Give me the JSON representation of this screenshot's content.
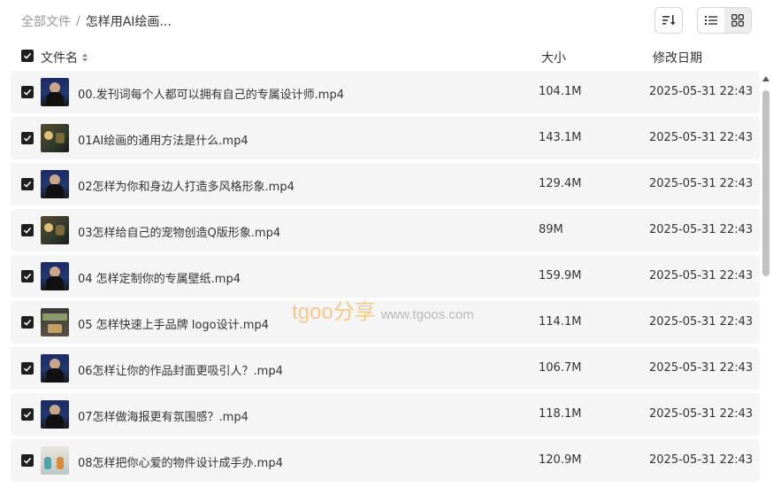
{
  "breadcrumb": {
    "root": "全部文件",
    "separator": "/",
    "current": "怎样用AI绘画..."
  },
  "toolbar": {
    "sort_icon": "sort-descending-icon",
    "list_view_icon": "list-view-icon",
    "grid_view_icon": "grid-view-icon",
    "active_view": "grid"
  },
  "header": {
    "name": "文件名",
    "size": "大小",
    "date": "修改日期"
  },
  "files": [
    {
      "name": "00.发刊词每个人都可以拥有自己的专属设计师.mp4",
      "size": "104.1M",
      "date": "2025-05-31 22:43",
      "thumb": "person",
      "checked": true
    },
    {
      "name": "01AI绘画的通用方法是什么.mp4",
      "size": "143.1M",
      "date": "2025-05-31 22:43",
      "thumb": "alt",
      "checked": true
    },
    {
      "name": "02怎样为你和身边人打造多风格形象.mp4",
      "size": "129.4M",
      "date": "2025-05-31 22:43",
      "thumb": "person",
      "checked": true
    },
    {
      "name": "03怎样给自己的宠物创造Q版形象.mp4",
      "size": "89M",
      "date": "2025-05-31 22:43",
      "thumb": "alt",
      "checked": true
    },
    {
      "name": "04 怎样定制你的专属壁纸.mp4",
      "size": "159.9M",
      "date": "2025-05-31 22:43",
      "thumb": "person",
      "checked": true
    },
    {
      "name": "05 怎样快速上手品牌 logo设计.mp4",
      "size": "114.1M",
      "date": "2025-05-31 22:43",
      "thumb": "dark2",
      "checked": true
    },
    {
      "name": "06怎样让你的作品封面更吸引人？.mp4",
      "size": "106.7M",
      "date": "2025-05-31 22:43",
      "thumb": "person",
      "checked": true
    },
    {
      "name": "07怎样做海报更有氛围感？.mp4",
      "size": "118.1M",
      "date": "2025-05-31 22:43",
      "thumb": "person",
      "checked": true
    },
    {
      "name": "08怎样把你心爱的物件设计成手办.mp4",
      "size": "120.9M",
      "date": "2025-05-31 22:43",
      "thumb": "light",
      "checked": true
    }
  ],
  "watermark": {
    "brand": "tgoo分享",
    "url": "www.tgoos.com"
  },
  "colors": {
    "row_bg": "#f5f5f5",
    "checkbox": "#1f1f1f",
    "watermark": "#f2a53a"
  }
}
